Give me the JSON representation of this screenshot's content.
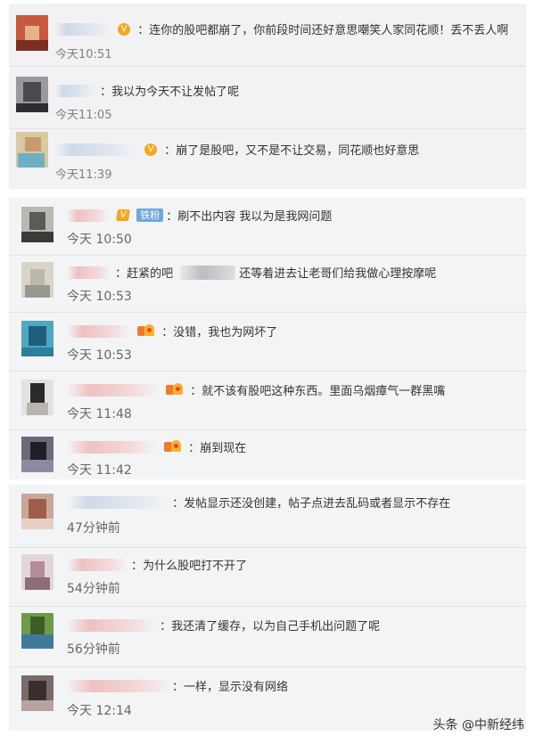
{
  "panels": [
    {
      "comments": [
        {
          "text": "：连你的股吧都崩了，你前段时间还好意思嘲笑人家同花顺！丢不丢人啊",
          "time": "今天10:51",
          "badge": "v-icon"
        },
        {
          "text": "：我以为今天不让发帖了呢",
          "time": "今天11:05"
        },
        {
          "text": "：崩了是股吧，又不是不让交易，同花顺也好意思",
          "time": "今天11:39",
          "badge": "v-icon"
        }
      ]
    },
    {
      "comments": [
        {
          "fan_badge": "铁粉",
          "text": "：刷不出内容 我以为是我网问题",
          "time": "今天 10:50",
          "badge": "v-icon"
        },
        {
          "text_pre": "：赶紧的吧",
          "text": "还等着进去让老哥们给我做心理按摩呢",
          "time": "今天 10:53"
        },
        {
          "text": "：没错，我也为网坏了",
          "time": "今天 10:53",
          "badge": "vip-icon"
        },
        {
          "text": "：就不该有股吧这种东西。里面乌烟瘴气一群黑嘴",
          "time": "今天 11:48",
          "badge": "vip-icon"
        },
        {
          "text": "：崩到现在",
          "time": "今天 11:42",
          "badge": "vip-icon"
        }
      ]
    },
    {
      "comments": [
        {
          "text": "：发帖显示还没创建，帖子点进去乱码或者显示不存在",
          "time": "47分钟前"
        },
        {
          "text": "：为什么股吧打不开了",
          "time": "54分钟前"
        },
        {
          "text": "：我还清了缓存，以为自己手机出问题了呢",
          "time": "56分钟前"
        },
        {
          "text": "：一样，显示没有网络",
          "time": "今天 12:14"
        }
      ]
    }
  ],
  "watermark": "头条 @中新经纬",
  "icons": {
    "verified_badge": "v-icon",
    "vip_badge": "vip-icon"
  },
  "colors": {
    "panel_bg": "#f2f2f5",
    "badge_orange": "#f5a623",
    "fan_badge_blue": "#6fa7d8",
    "time_gray": "#808080"
  }
}
